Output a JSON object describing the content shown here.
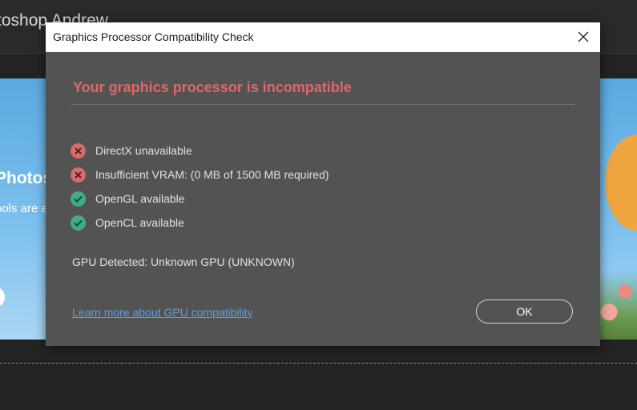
{
  "background_app": {
    "title": "toshop Andrew",
    "banner_heading": "Photos",
    "banner_subtext": "ools are a"
  },
  "dialog": {
    "title": "Graphics Processor Compatibility Check",
    "close_icon": "close-icon",
    "heading": "Your graphics processor is incompatible",
    "checks": [
      {
        "label": "DirectX unavailable",
        "status": "error",
        "icon": "error-x-icon"
      },
      {
        "label": "Insufficient VRAM: (0 MB of 1500 MB required)",
        "status": "error",
        "icon": "error-x-icon"
      },
      {
        "label": "OpenGL available",
        "status": "ok",
        "icon": "check-icon"
      },
      {
        "label": "OpenCL available",
        "status": "ok",
        "icon": "check-icon"
      }
    ],
    "gpu_detected": "GPU Detected: Unknown GPU (UNKNOWN)",
    "learn_more_link": "Learn more about GPU compatibility",
    "ok_button": "OK"
  },
  "colors": {
    "heading_red": "#e06767",
    "error_red": "#d96a6a",
    "ok_green": "#3fae85",
    "link_blue": "#5aa0e6",
    "dialog_bg": "#535353"
  }
}
